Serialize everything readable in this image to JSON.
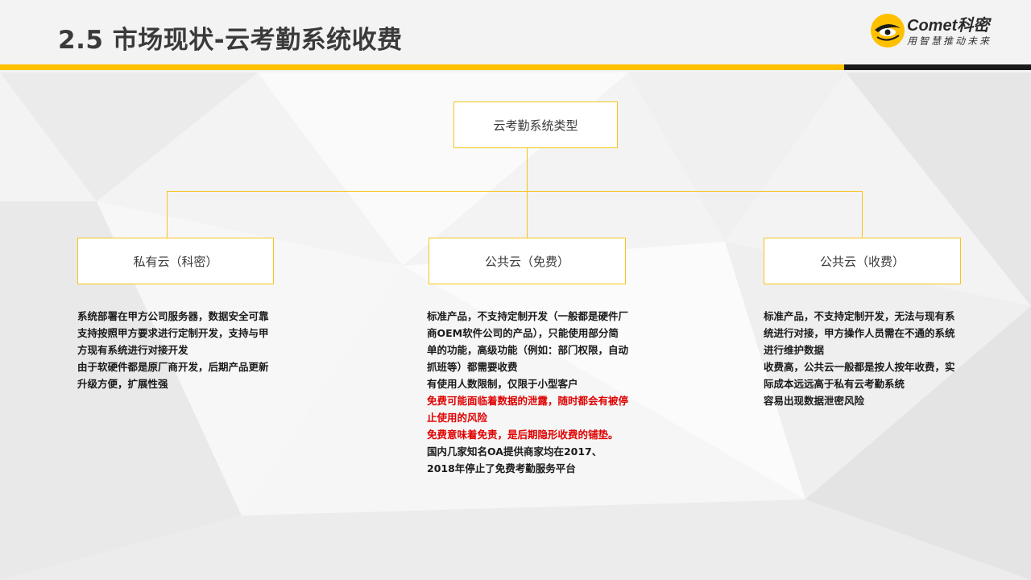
{
  "title": "2.5 市场现状-云考勤系统收费",
  "logo": {
    "brand": "Comet",
    "brand_cn": "科密",
    "slogan": "用智慧推动未来"
  },
  "colors": {
    "accent": "#ffc000",
    "warning_text": "#e00000",
    "dark_bar": "#1a1a1a"
  },
  "diagram": {
    "root": {
      "label": "云考勤系统类型"
    },
    "children": [
      {
        "label": "私有云（科密）",
        "notes": [
          {
            "text": "系统部署在甲方公司服务器，数据安全可靠",
            "highlight": false
          },
          {
            "text": "支持按照甲方要求进行定制开发，支持与甲方现有系统进行对接开发",
            "highlight": false
          },
          {
            "text": "由于软硬件都是原厂商开发，后期产品更新升级方便，扩展性强",
            "highlight": false
          }
        ]
      },
      {
        "label": "公共云（免费）",
        "notes": [
          {
            "text": "标准产品，不支持定制开发（一般都是硬件厂商OEM软件公司的产品），只能使用部分简单的功能，高级功能（例如：部门权限，自动抓班等）都需要收费",
            "highlight": false
          },
          {
            "text": "有使用人数限制，仅限于小型客户",
            "highlight": false
          },
          {
            "text": "免费可能面临着数据的泄露，随时都会有被停止使用的风险",
            "highlight": true
          },
          {
            "text": "免费意味着免责，是后期隐形收费的铺垫。",
            "highlight": true
          },
          {
            "text": "国内几家知名OA提供商家均在2017、2018年停止了免费考勤服务平台",
            "highlight": false
          }
        ]
      },
      {
        "label": "公共云（收费）",
        "notes": [
          {
            "text": "标准产品，不支持定制开发，无法与现有系统进行对接，甲方操作人员需在不通的系统进行维护数据",
            "highlight": false
          },
          {
            "text": "收费高，公共云一般都是按人按年收费，实际成本远远高于私有云考勤系统",
            "highlight": false
          },
          {
            "text": "容易出现数据泄密风险",
            "highlight": false
          }
        ]
      }
    ]
  }
}
